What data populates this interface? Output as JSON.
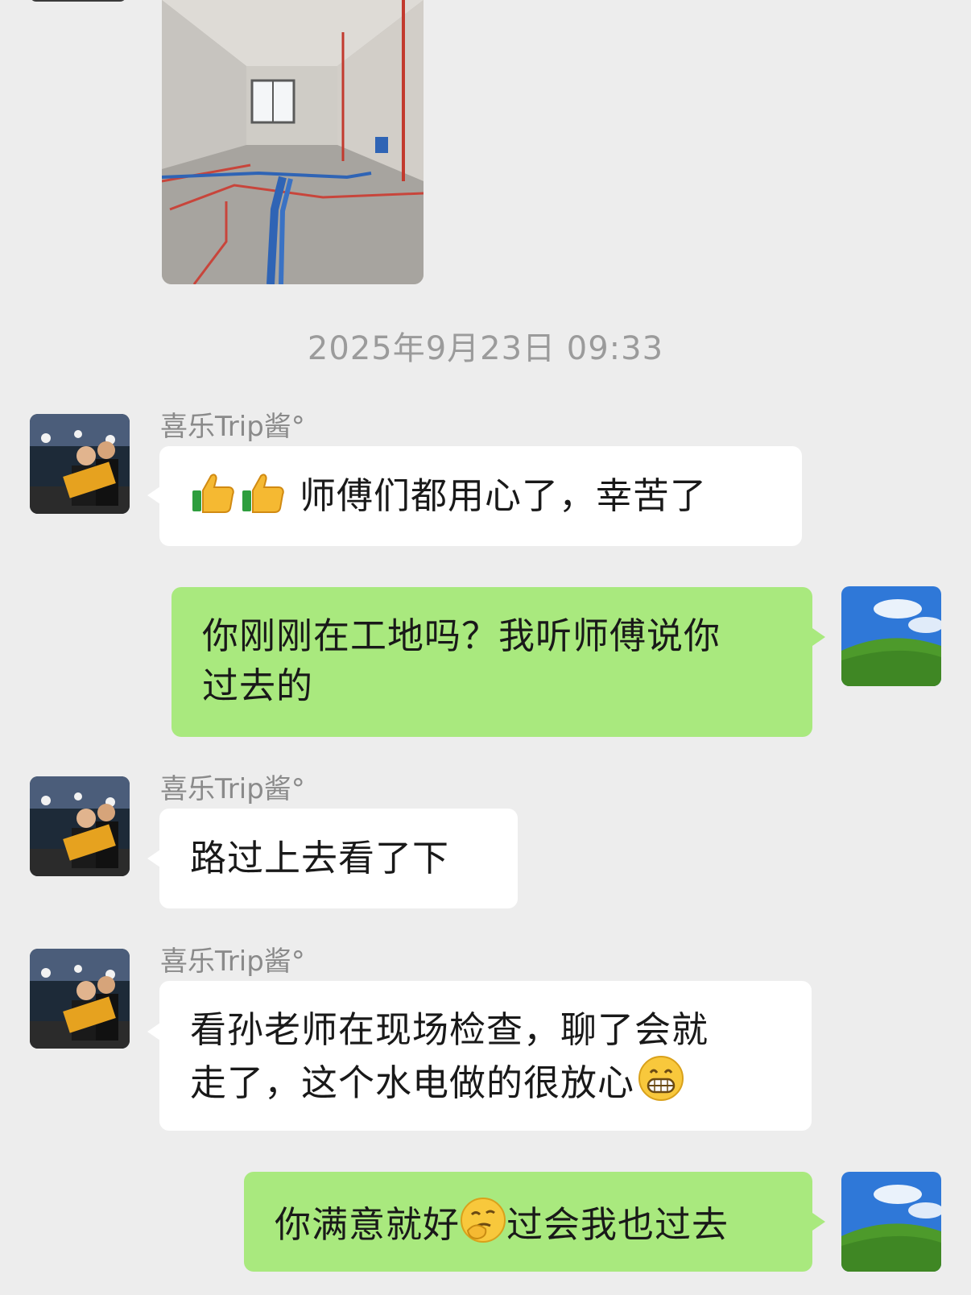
{
  "timestamp": "2025年9月23日 09:33",
  "photo": {
    "alt": "construction-site-photo"
  },
  "messages": [
    {
      "sender": "喜乐Trip酱°",
      "side": "left",
      "text": "师傅们都用心了，幸苦了",
      "emoji_prefix": [
        "thumbs-up",
        "thumbs-up"
      ]
    },
    {
      "side": "right",
      "line1": "你刚刚在工地吗？我听师傅说你",
      "line2": "过去的"
    },
    {
      "sender": "喜乐Trip酱°",
      "side": "left",
      "text": "路过上去看了下"
    },
    {
      "sender": "喜乐Trip酱°",
      "side": "left",
      "line1": "看孙老师在现场检查，聊了会就",
      "line2": "走了，这个水电做的很放心",
      "emoji_suffix": "grinning-face"
    },
    {
      "side": "right",
      "text_a": "你满意就好",
      "emoji_mid": "thinking-shush-face",
      "text_b": "过会我也过去"
    }
  ]
}
